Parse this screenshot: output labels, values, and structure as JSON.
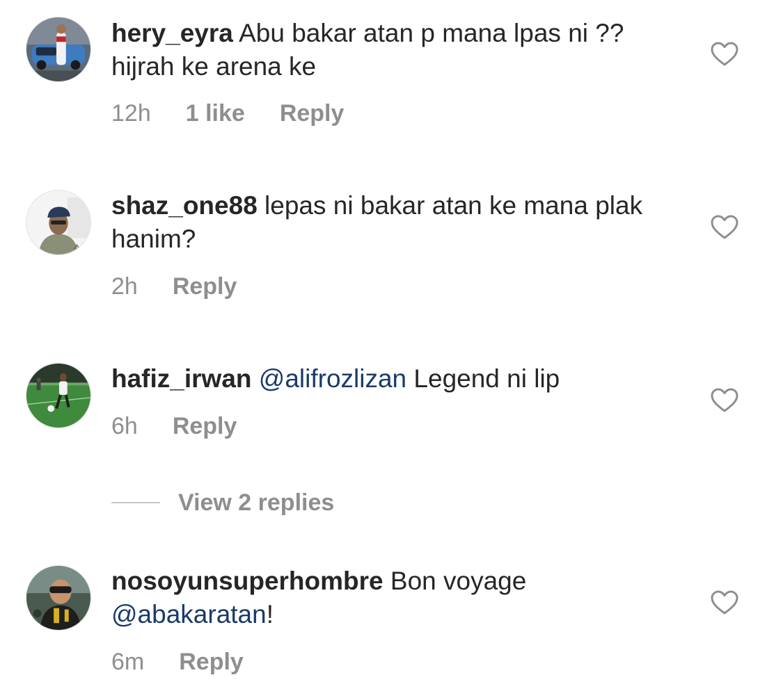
{
  "comments": [
    {
      "username": "hery_eyra",
      "text_before": " Abu bakar atan p mana lpas ni ??hijrah ke arena ke",
      "mention": "",
      "text_after": "",
      "time": "12h",
      "likes": "1 like",
      "reply": "Reply",
      "avatar_icon": "user-avatar-car-photo"
    },
    {
      "username": "shaz_one88",
      "text_before": " lepas ni bakar atan ke mana plak hanim?",
      "mention": "",
      "text_after": "",
      "time": "2h",
      "likes": "",
      "reply": "Reply",
      "avatar_icon": "user-avatar-cap-photo"
    },
    {
      "username": "hafiz_irwan",
      "text_before": " ",
      "mention": "@alifrozlizan",
      "text_after": " Legend ni lip",
      "time": "6h",
      "likes": "",
      "reply": "Reply",
      "avatar_icon": "user-avatar-football-photo"
    },
    {
      "username": "nosoyunsuperhombre",
      "text_before": " Bon voyage ",
      "mention": "@abakaratan",
      "text_after": "!",
      "time": "6m",
      "likes": "",
      "reply": "Reply",
      "avatar_icon": "user-avatar-diver-photo"
    }
  ],
  "view_replies": {
    "label": "View 2 replies"
  },
  "colors": {
    "text": "#262626",
    "secondary": "#8e8e8e",
    "mention": "#1b3a6b",
    "heart_outline": "#8e8e8e"
  }
}
